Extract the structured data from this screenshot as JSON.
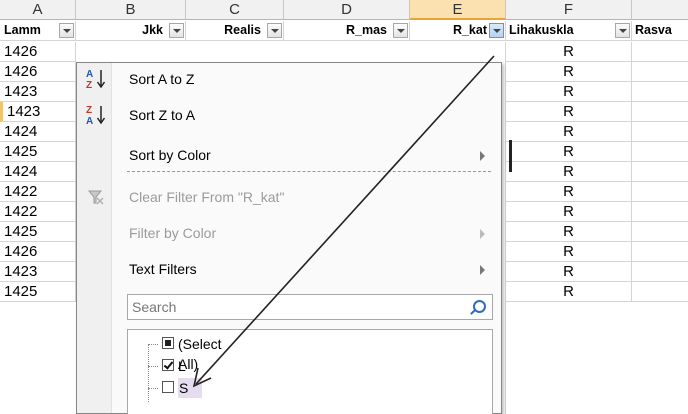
{
  "columns": {
    "letters": [
      "A",
      "B",
      "C",
      "D",
      "E",
      "F"
    ],
    "selected_letter": "E"
  },
  "headers": [
    "Lamm",
    "Jkk",
    "Realis",
    "R_mas",
    "R_kat",
    "Lihakuskla",
    "Rasva"
  ],
  "rows": [
    {
      "a": "1426",
      "f": "R"
    },
    {
      "a": "1426",
      "f": "R"
    },
    {
      "a": "1423",
      "f": "R"
    },
    {
      "a": "1423",
      "f": "R"
    },
    {
      "a": "1424",
      "f": "R"
    },
    {
      "a": "1425",
      "f": "R"
    },
    {
      "a": "1424",
      "f": "R"
    },
    {
      "a": "1422",
      "f": "R"
    },
    {
      "a": "1422",
      "f": "R"
    },
    {
      "a": "1425",
      "f": "R"
    },
    {
      "a": "1426",
      "f": "R"
    },
    {
      "a": "1423",
      "f": "R"
    },
    {
      "a": "1425",
      "f": "R"
    }
  ],
  "menu": {
    "sort_az": "Sort A to Z",
    "sort_za": "Sort Z to A",
    "sort_color": "Sort by Color",
    "clear_filter": "Clear Filter From \"R_kat\"",
    "filter_color": "Filter by Color",
    "text_filters": "Text Filters",
    "search_placeholder": "Search",
    "items": [
      {
        "label": "(Select All)",
        "state": "partial"
      },
      {
        "label": "L",
        "state": "checked"
      },
      {
        "label": "S",
        "state": "unchecked"
      }
    ]
  },
  "colors": {
    "arrow": "#222222",
    "selected_column": "#fbe1b0",
    "highlight_s": "#e6dcf0"
  }
}
